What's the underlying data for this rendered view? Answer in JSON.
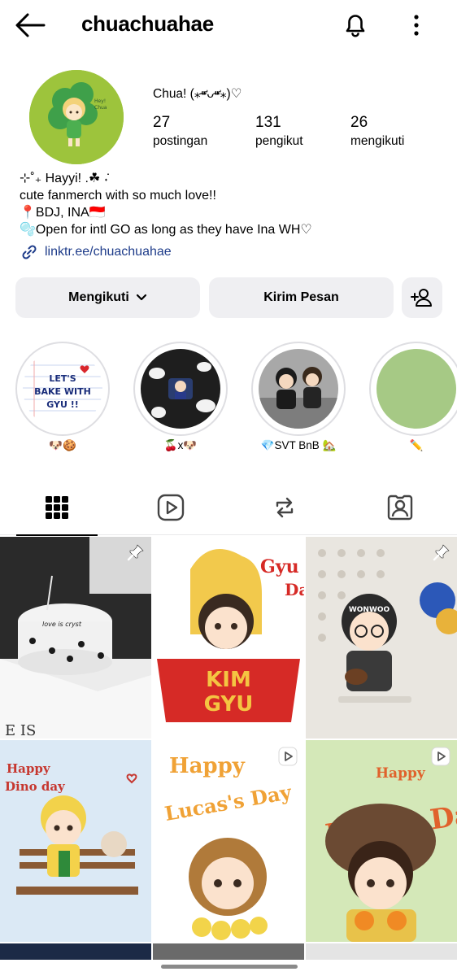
{
  "header": {
    "username": "chuachuahae"
  },
  "profile": {
    "display_name": "Chua! (⁎⁍̴̛ᴗ⁍̴̛⁎)♡",
    "stats": [
      {
        "value": "27",
        "label": "postingan"
      },
      {
        "value": "131",
        "label": "pengikut"
      },
      {
        "value": "26",
        "label": "mengikuti"
      }
    ],
    "bio": [
      "⊹˚₊ Hayyi! .☘︎ ݁˖",
      "cute fanmerch with so much love!!",
      "📍BDJ, INA🇮🇩",
      "🫧Open for intl GO as long as they have Ina WH♡"
    ],
    "link": "linktr.ee/chuachuahae"
  },
  "actions": {
    "follow_label": "Mengikuti",
    "message_label": "Kirim Pesan"
  },
  "highlights": [
    {
      "label": "🐶🍪",
      "image_text": "LET'S BAKE WITH GYU !!"
    },
    {
      "label": "🍒x🐶"
    },
    {
      "label": "💎SVT BnB 🏡"
    },
    {
      "label": "✏️"
    }
  ],
  "grid": [
    {
      "pinned": true,
      "video": false,
      "image_text": "love is cryst"
    },
    {
      "pinned": false,
      "video": false,
      "image_text": "KIM GYU"
    },
    {
      "pinned": true,
      "video": false,
      "image_text": "WONWOO"
    },
    {
      "pinned": false,
      "video": false,
      "image_text": "Happy Dino day"
    },
    {
      "pinned": false,
      "video": true,
      "image_text": "Happy Lucas's Day"
    },
    {
      "pinned": false,
      "video": true,
      "image_text": "Happy DOO's Day"
    }
  ],
  "colors": {
    "button_bg": "#efeff2",
    "link": "#1e3c8a",
    "avatar_bg": "#9dc43c",
    "highlight_4": "#a6c985"
  }
}
